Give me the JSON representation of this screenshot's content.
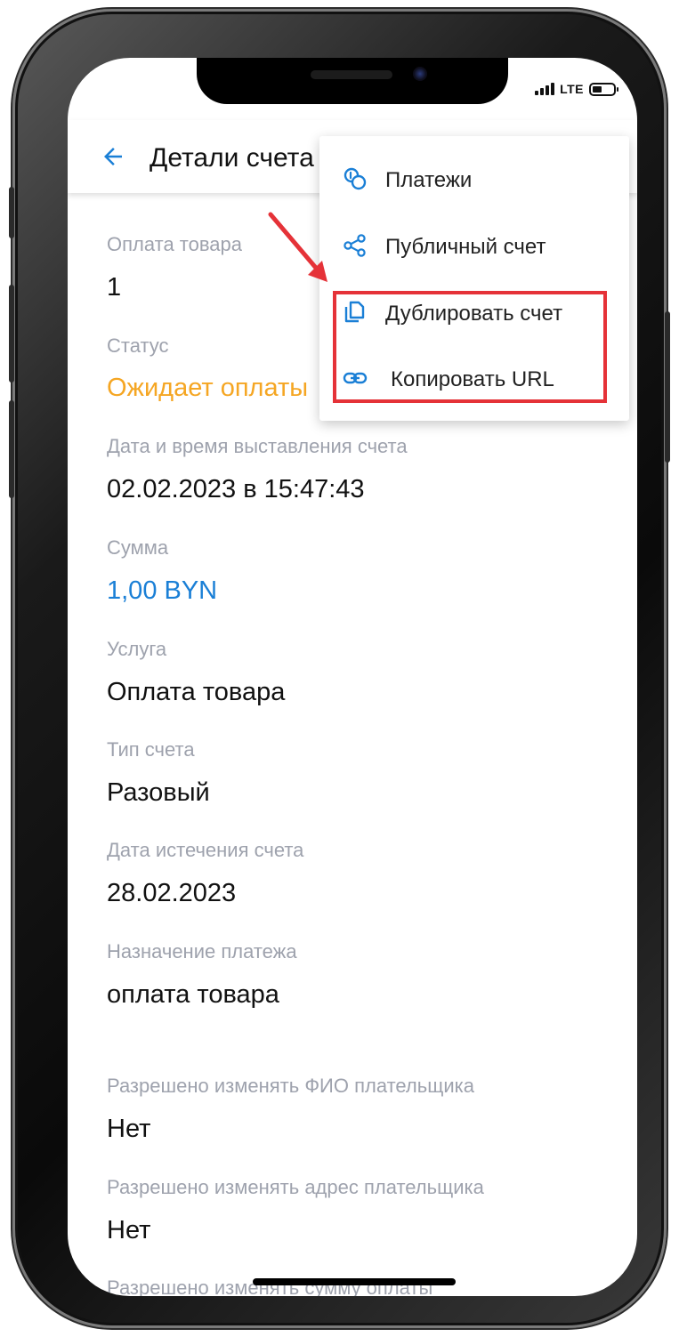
{
  "status_bar": {
    "network": "LTE"
  },
  "appbar": {
    "title": "Детали счета"
  },
  "menu": {
    "items": [
      {
        "label": "Платежи",
        "icon": "payments-icon"
      },
      {
        "label": "Публичный счет",
        "icon": "share-icon"
      },
      {
        "label": "Дублировать счет",
        "icon": "copy-icon"
      },
      {
        "label": "Копировать URL",
        "icon": "link-icon"
      }
    ]
  },
  "fields": [
    {
      "label": "Оплата товара",
      "value": "1"
    },
    {
      "label": "Статус",
      "value": "Ожидает оплаты"
    },
    {
      "label": "Дата и время выставления счета",
      "value": "02.02.2023 в 15:47:43"
    },
    {
      "label": "Сумма",
      "value": "1,00 BYN"
    },
    {
      "label": "Услуга",
      "value": "Оплата товара"
    },
    {
      "label": "Тип счета",
      "value": "Разовый"
    },
    {
      "label": "Дата истечения счета",
      "value": "28.02.2023"
    },
    {
      "label": "Назначение платежа",
      "value": "оплата товара"
    },
    {
      "label": "Разрешено изменять ФИО плательщика",
      "value": "Нет"
    },
    {
      "label": "Разрешено изменять адрес плательщика",
      "value": "Нет"
    },
    {
      "label": "Разрешено изменять сумму оплаты",
      "value": ""
    }
  ],
  "colors": {
    "accent": "#1a7fd6",
    "status_pending": "#f5a623",
    "label": "#9ea2ad",
    "highlight": "#e53238"
  }
}
